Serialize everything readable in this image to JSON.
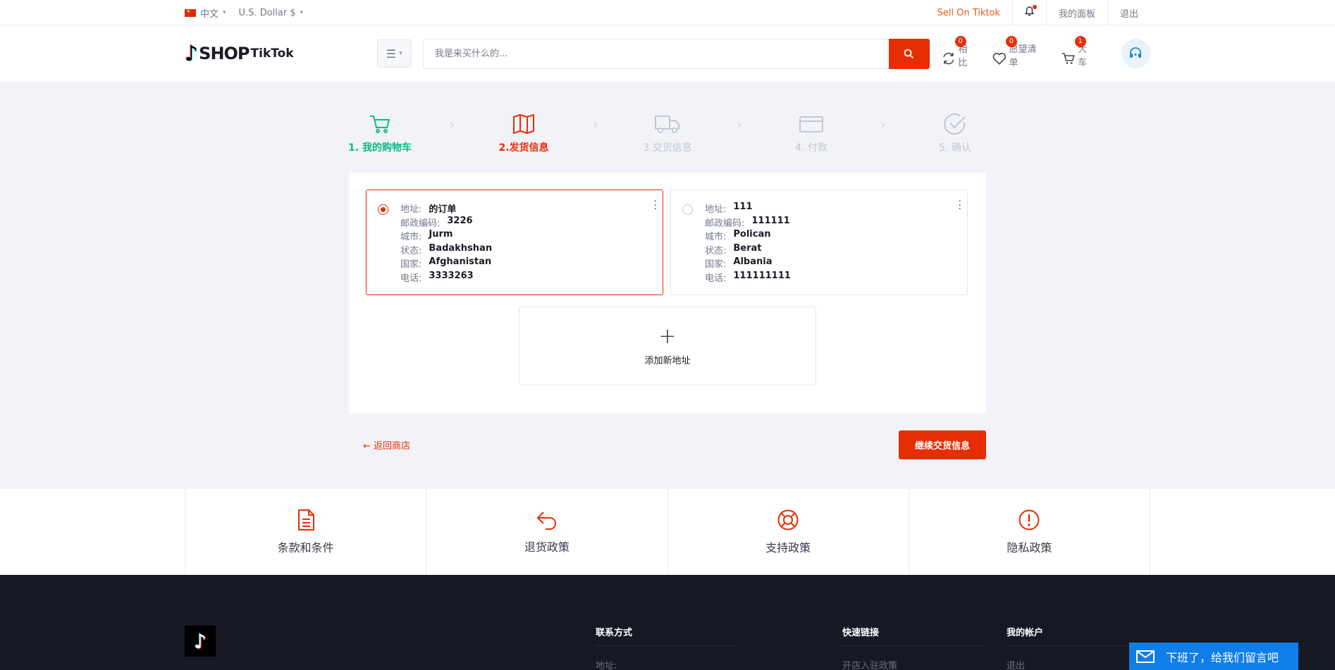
{
  "topbar": {
    "language": "中文",
    "currency": "U.S. Dollar $",
    "sell": "Sell On Tiktok",
    "dashboard": "我的面板",
    "logout": "退出"
  },
  "header": {
    "logo_shop": "SHOP",
    "logo_tiktok": "TikTok",
    "search_placeholder": "我是来买什么的...",
    "compare": {
      "count": "0",
      "label": "相比"
    },
    "wishlist": {
      "count": "0",
      "label": "愿望清单"
    },
    "cart": {
      "count": "1",
      "label": "大车"
    }
  },
  "steps": [
    {
      "label": "1. 我的购物车",
      "state": "done"
    },
    {
      "label": "2.发货信息",
      "state": "active"
    },
    {
      "label": "3.交货信息",
      "state": "todo"
    },
    {
      "label": "4. 付款",
      "state": "todo"
    },
    {
      "label": "5. 确认",
      "state": "todo"
    }
  ],
  "address_labels": {
    "address": "地址:",
    "postal": "邮政编码:",
    "city": "城市:",
    "state": "状态:",
    "country": "国家:",
    "phone": "电话:"
  },
  "addresses": [
    {
      "address": "的订单",
      "postal": "3226",
      "city": "Jurm",
      "state": "Badakhshan",
      "country": "Afghanistan",
      "phone": "3333263",
      "selected": true
    },
    {
      "address": "111",
      "postal": "111111",
      "city": "Polican",
      "state": "Berat",
      "country": "Albania",
      "phone": "111111111",
      "selected": false
    }
  ],
  "add_new": "添加新地址",
  "actions": {
    "back": "返回商店",
    "continue": "继续交货信息"
  },
  "policies": [
    {
      "label": "条款和条件",
      "icon": "document-icon"
    },
    {
      "label": "退货政策",
      "icon": "return-arrow-icon"
    },
    {
      "label": "支持政策",
      "icon": "lifebuoy-icon"
    },
    {
      "label": "隐私政策",
      "icon": "exclamation-circle-icon"
    }
  ],
  "footer": {
    "contact": {
      "title": "联系方式",
      "first": "地址:"
    },
    "quick_links": {
      "title": "快速链接",
      "first": "开店入驻政策"
    },
    "account": {
      "title": "我的帐户",
      "first": "退出"
    }
  },
  "chat": "下班了，给我们留言吧",
  "colors": {
    "accent": "#e62e04",
    "success": "#0abb87",
    "footer_bg": "#161824",
    "chat_blue": "#0f7ee8"
  }
}
